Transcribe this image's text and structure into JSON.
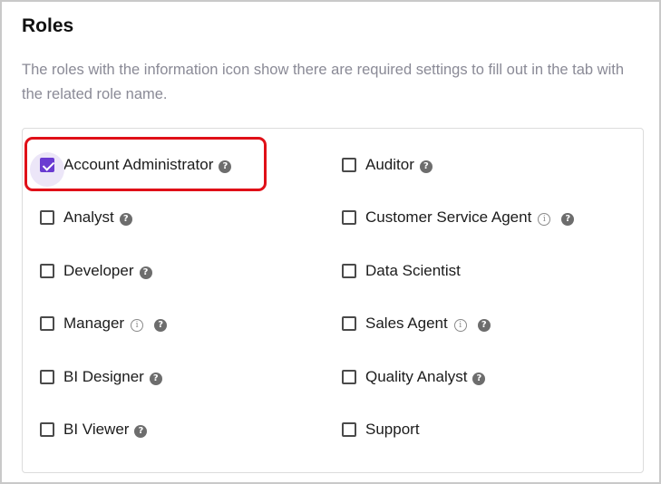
{
  "section": {
    "title": "Roles",
    "description": "The roles with the information icon show there are required settings to fill out in the tab with the related role name."
  },
  "roles": [
    {
      "label": "Account Administrator",
      "checked": true,
      "info": false,
      "help": true
    },
    {
      "label": "Auditor",
      "checked": false,
      "info": false,
      "help": true
    },
    {
      "label": "Analyst",
      "checked": false,
      "info": false,
      "help": true
    },
    {
      "label": "Customer Service Agent",
      "checked": false,
      "info": true,
      "help": true
    },
    {
      "label": "Developer",
      "checked": false,
      "info": false,
      "help": true
    },
    {
      "label": "Data Scientist",
      "checked": false,
      "info": false,
      "help": false
    },
    {
      "label": "Manager",
      "checked": false,
      "info": true,
      "help": true
    },
    {
      "label": "Sales Agent",
      "checked": false,
      "info": true,
      "help": true
    },
    {
      "label": "BI Designer",
      "checked": false,
      "info": false,
      "help": true
    },
    {
      "label": "Quality Analyst",
      "checked": false,
      "info": false,
      "help": true
    },
    {
      "label": "BI Viewer",
      "checked": false,
      "info": false,
      "help": true
    },
    {
      "label": "Support",
      "checked": false,
      "info": false,
      "help": false
    }
  ],
  "icons": {
    "help": "?",
    "info": "i"
  },
  "colors": {
    "accent": "#6a3bd1",
    "highlight": "#e01018",
    "description_text": "#8a8a96"
  }
}
